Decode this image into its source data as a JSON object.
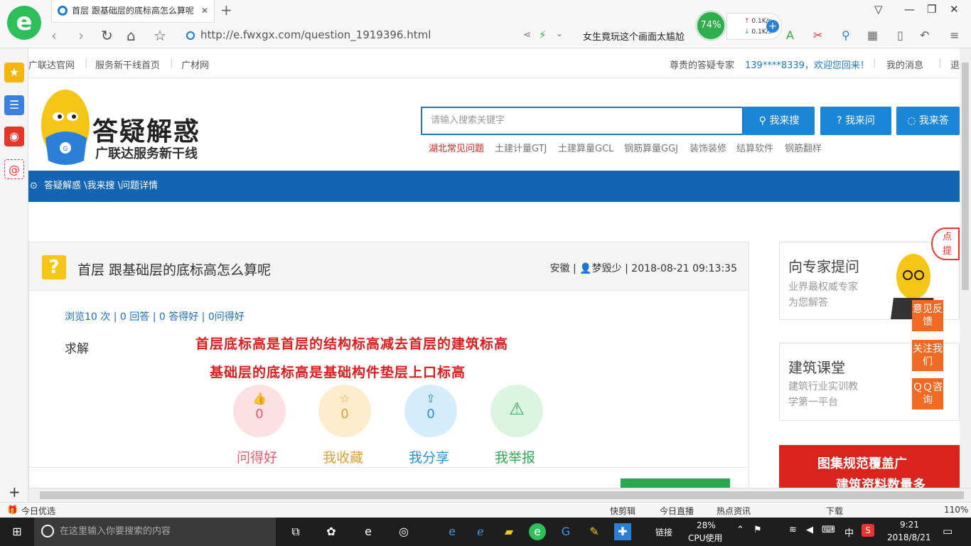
{
  "browser": {
    "tab_title": "首层 跟基础层的底标高怎么算呢",
    "url": "http://e.fwxgx.com/question_1919396.html",
    "news_ticker": "女生竟玩这个画面太尴尬",
    "cpu_percent": "74%",
    "net_up": "0.1K/s",
    "net_down": "0.1K/s",
    "zoom": "110%",
    "status_left": "今日优选",
    "status_items": [
      "快剪辑",
      "今日直播",
      "热点资讯",
      "下载"
    ]
  },
  "taskbar": {
    "search_placeholder": "在这里输入你要搜索的内容",
    "link_label": "链接",
    "cpu": "28%",
    "cpu_label": "CPU使用",
    "ime": "中",
    "time": "9:21",
    "date": "2018/8/21"
  },
  "topnav": {
    "links": [
      "广联达官网",
      "服务新干线首页",
      "广材网"
    ],
    "welcome_prefix": "尊贵的答疑专家",
    "user": "139****8339，欢迎您回来！",
    "messages": "我的消息",
    "logout": "退"
  },
  "site": {
    "title": "答疑解惑",
    "subtitle": "广联达服务新干线",
    "search_placeholder": "请输入搜索关键字",
    "btn_search": "我来搜",
    "btn_ask": "我来问",
    "btn_answer": "我来答",
    "hot_tags": [
      "湖北常见问题",
      "土建计量GTJ",
      "土建算量GCL",
      "钢筋算量GGJ",
      "装饰装修",
      "结算软件",
      "钢筋翻样"
    ]
  },
  "breadcrumb": "答疑解惑 \\我来搜 \\问题详情",
  "question": {
    "title": "首层 跟基础层的底标高怎么算呢",
    "region": "安徽",
    "author": "梦毁少",
    "time": "2018-08-21 09:13:35",
    "stats": "浏览10 次 | 0 回答 | 0 答得好 | 0问得好",
    "body": "求解",
    "note1": "首层底标高是首层的结构标高减去首层的建筑标高",
    "note2": "基础层的底标高是基础构件垫层上口标高",
    "actions": [
      {
        "label": "问得好",
        "count": "0",
        "icon": "thumbs-up-icon",
        "color": "#e8596b",
        "bg": "#fde0e4"
      },
      {
        "label": "我收藏",
        "count": "0",
        "icon": "star-icon",
        "color": "#d9a13b",
        "bg": "#fdeccd"
      },
      {
        "label": "我分享",
        "count": "0",
        "icon": "share-icon",
        "color": "#2b8fd6",
        "bg": "#d4ecfb"
      },
      {
        "label": "我举报",
        "count": "",
        "icon": "warning-icon",
        "color": "#33a855",
        "bg": "#dcf5e1"
      }
    ]
  },
  "sidebar": {
    "card1_title": "向专家提问",
    "card1_desc1": "业界最权威专家",
    "card1_desc2": "为您解答",
    "card2_title": "建筑课堂",
    "card2_desc1": "建筑行业实训教",
    "card2_desc2": "学第一平台",
    "float_feedback": "意见反馈",
    "float_follow": "关注我们",
    "float_qq": "ＱＱ咨询",
    "bubble": "点提问",
    "banner_text1": "图集规范覆盖广",
    "banner_text2": "建筑资料数量多"
  }
}
